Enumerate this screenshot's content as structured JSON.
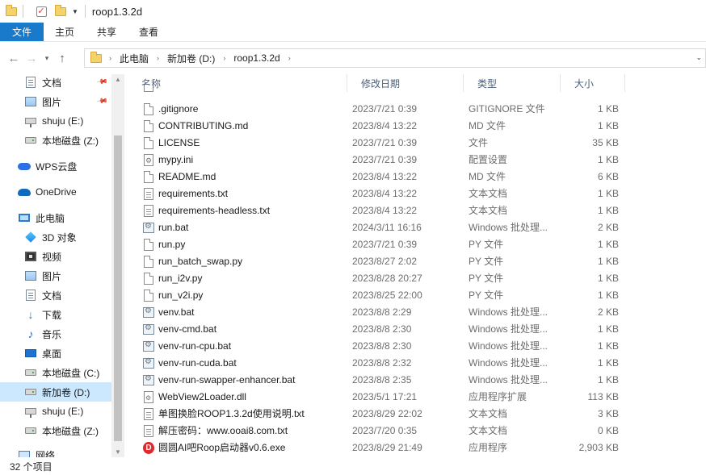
{
  "window": {
    "title": "roop1.3.2d"
  },
  "ribbon": {
    "tabs": [
      "文件",
      "主页",
      "共享",
      "查看"
    ]
  },
  "address": {
    "breadcrumbs": [
      "此电脑",
      "新加卷 (D:)",
      "roop1.3.2d"
    ]
  },
  "nav": {
    "items": [
      {
        "label": "文档",
        "icon": "document-icon",
        "pinned": true
      },
      {
        "label": "图片",
        "icon": "pictures-icon",
        "pinned": true
      },
      {
        "label": "shuju (E:)",
        "icon": "network-drive-icon"
      },
      {
        "label": "本地磁盘 (Z:)",
        "icon": "drive-icon"
      },
      {
        "label": "WPS云盘",
        "icon": "wps-cloud-icon"
      },
      {
        "label": "OneDrive",
        "icon": "onedrive-icon"
      },
      {
        "label": "此电脑",
        "icon": "this-pc-icon"
      },
      {
        "label": "3D 对象",
        "icon": "3d-objects-icon"
      },
      {
        "label": "视频",
        "icon": "video-icon"
      },
      {
        "label": "图片",
        "icon": "pictures-icon"
      },
      {
        "label": "文档",
        "icon": "document-icon"
      },
      {
        "label": "下载",
        "icon": "download-icon"
      },
      {
        "label": "音乐",
        "icon": "music-icon"
      },
      {
        "label": "桌面",
        "icon": "desktop-icon"
      },
      {
        "label": "本地磁盘 (C:)",
        "icon": "drive-icon"
      },
      {
        "label": "新加卷 (D:)",
        "icon": "drive-icon",
        "selected": true
      },
      {
        "label": "shuju (E:)",
        "icon": "network-drive-icon"
      },
      {
        "label": "本地磁盘 (Z:)",
        "icon": "drive-icon"
      },
      {
        "label": "网络",
        "icon": "network-icon"
      }
    ]
  },
  "columns": {
    "name": "名称",
    "date": "修改日期",
    "type": "类型",
    "size": "大小"
  },
  "files": [
    {
      "name": ".gitignore",
      "date": "2023/7/21 0:39",
      "type": "GITIGNORE 文件",
      "size": "1 KB",
      "icon": "blank-file-icon"
    },
    {
      "name": "CONTRIBUTING.md",
      "date": "2023/8/4 13:22",
      "type": "MD 文件",
      "size": "1 KB",
      "icon": "blank-file-icon"
    },
    {
      "name": "LICENSE",
      "date": "2023/7/21 0:39",
      "type": "文件",
      "size": "35 KB",
      "icon": "blank-file-icon"
    },
    {
      "name": "mypy.ini",
      "date": "2023/7/21 0:39",
      "type": "配置设置",
      "size": "1 KB",
      "icon": "settings-file-icon"
    },
    {
      "name": "README.md",
      "date": "2023/8/4 13:22",
      "type": "MD 文件",
      "size": "6 KB",
      "icon": "blank-file-icon"
    },
    {
      "name": "requirements.txt",
      "date": "2023/8/4 13:22",
      "type": "文本文档",
      "size": "1 KB",
      "icon": "text-file-icon"
    },
    {
      "name": "requirements-headless.txt",
      "date": "2023/8/4 13:22",
      "type": "文本文档",
      "size": "1 KB",
      "icon": "text-file-icon"
    },
    {
      "name": "run.bat",
      "date": "2024/3/11 16:16",
      "type": "Windows 批处理...",
      "size": "2 KB",
      "icon": "batch-file-icon"
    },
    {
      "name": "run.py",
      "date": "2023/7/21 0:39",
      "type": "PY 文件",
      "size": "1 KB",
      "icon": "blank-file-icon"
    },
    {
      "name": "run_batch_swap.py",
      "date": "2023/8/27 2:02",
      "type": "PY 文件",
      "size": "1 KB",
      "icon": "blank-file-icon"
    },
    {
      "name": "run_i2v.py",
      "date": "2023/8/28 20:27",
      "type": "PY 文件",
      "size": "1 KB",
      "icon": "blank-file-icon"
    },
    {
      "name": "run_v2i.py",
      "date": "2023/8/25 22:00",
      "type": "PY 文件",
      "size": "1 KB",
      "icon": "blank-file-icon"
    },
    {
      "name": "venv.bat",
      "date": "2023/8/8 2:29",
      "type": "Windows 批处理...",
      "size": "2 KB",
      "icon": "batch-file-icon"
    },
    {
      "name": "venv-cmd.bat",
      "date": "2023/8/8 2:30",
      "type": "Windows 批处理...",
      "size": "1 KB",
      "icon": "batch-file-icon"
    },
    {
      "name": "venv-run-cpu.bat",
      "date": "2023/8/8 2:30",
      "type": "Windows 批处理...",
      "size": "1 KB",
      "icon": "batch-file-icon"
    },
    {
      "name": "venv-run-cuda.bat",
      "date": "2023/8/8 2:32",
      "type": "Windows 批处理...",
      "size": "1 KB",
      "icon": "batch-file-icon"
    },
    {
      "name": "venv-run-swapper-enhancer.bat",
      "date": "2023/8/8 2:35",
      "type": "Windows 批处理...",
      "size": "1 KB",
      "icon": "batch-file-icon"
    },
    {
      "name": "WebView2Loader.dll",
      "date": "2023/5/1 17:21",
      "type": "应用程序扩展",
      "size": "113 KB",
      "icon": "dll-file-icon"
    },
    {
      "name": "单图换脸ROOP1.3.2d使用说明.txt",
      "date": "2023/8/29 22:02",
      "type": "文本文档",
      "size": "3 KB",
      "icon": "text-file-icon"
    },
    {
      "name": "解压密码：www.ooai8.com.txt",
      "date": "2023/7/20 0:35",
      "type": "文本文档",
      "size": "0 KB",
      "icon": "text-file-icon"
    },
    {
      "name": "圆圆AI吧Roop启动器v0.6.exe",
      "date": "2023/8/29 21:49",
      "type": "应用程序",
      "size": "2,903 KB",
      "icon": "app-exe-icon"
    }
  ],
  "status": {
    "item_count": "32 个项目"
  }
}
